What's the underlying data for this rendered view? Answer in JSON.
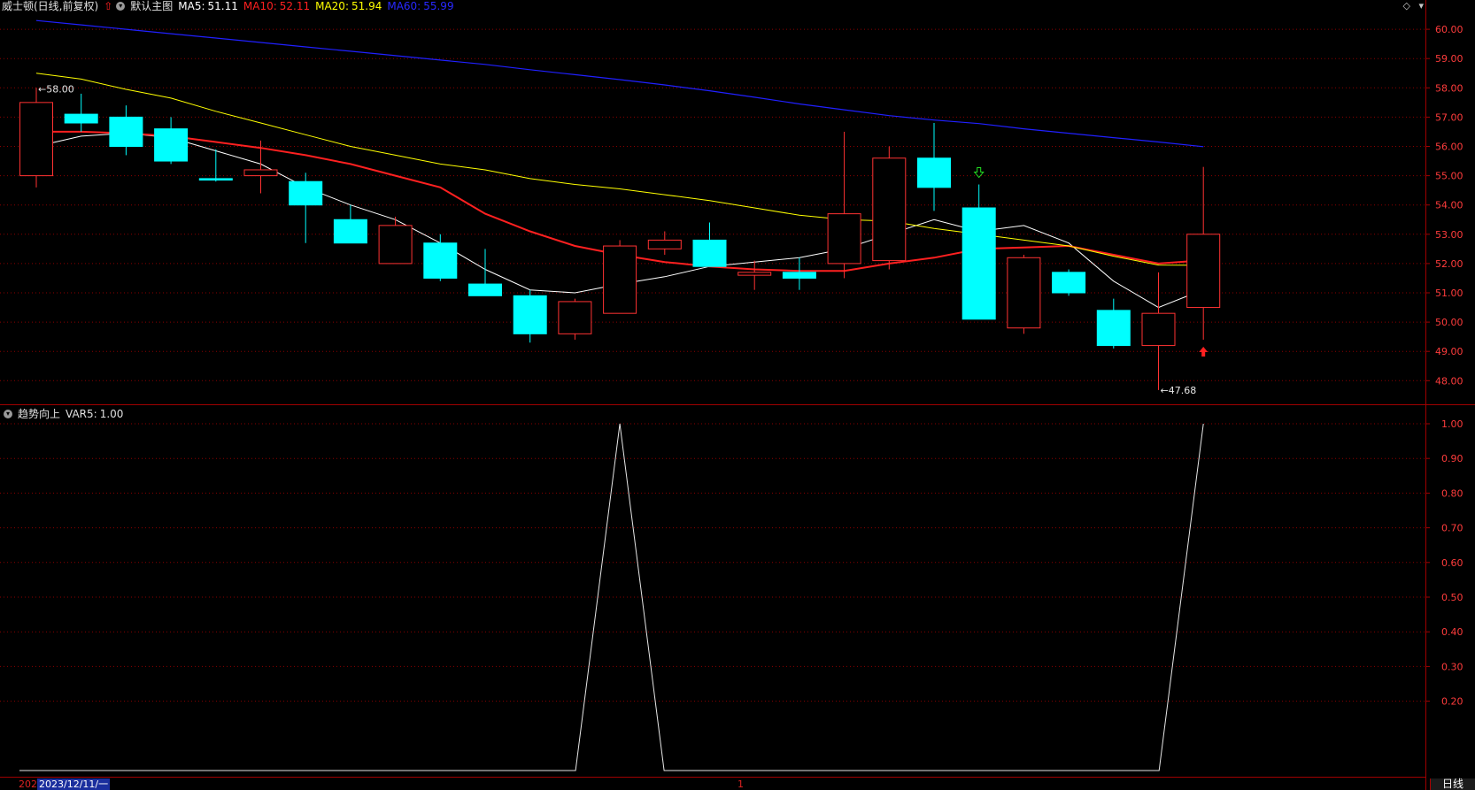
{
  "header": {
    "stock_title": "威士顿(日线,前复权)",
    "main_chart_name": "默认主图",
    "ma5": {
      "label": "MA5:",
      "value": "51.11",
      "color": "#ffffff"
    },
    "ma10": {
      "label": "MA10:",
      "value": "52.11",
      "color": "#ff2020"
    },
    "ma20": {
      "label": "MA20:",
      "value": "51.94",
      "color": "#ffff00"
    },
    "ma60": {
      "label": "MA60:",
      "value": "55.99",
      "color": "#2020ff"
    }
  },
  "indicator": {
    "name": "趋势向上",
    "var_label": "VAR5:",
    "var_value": "1.00"
  },
  "footer": {
    "date_year": "202",
    "selected_date": "2023/12/11/一",
    "marker": "1",
    "period": "日线"
  },
  "colors": {
    "up": "#ff3232",
    "down": "#00ffff",
    "grid": "#8b0000",
    "background": "#000000"
  },
  "chart_data": [
    {
      "type": "candlestick",
      "y_axis": [
        "60.00",
        "59.00",
        "58.00",
        "57.00",
        "56.00",
        "55.00",
        "54.00",
        "53.00",
        "52.00",
        "51.00",
        "50.00",
        "49.00",
        "48.00"
      ],
      "ylim": [
        47.68,
        60.0
      ],
      "annotations": {
        "high_label": "58.00",
        "low_label": "47.68"
      },
      "candles": [
        {
          "o": 55.0,
          "h": 58.0,
          "l": 54.6,
          "c": 57.5
        },
        {
          "o": 57.1,
          "h": 57.8,
          "l": 56.5,
          "c": 56.8
        },
        {
          "o": 57.0,
          "h": 57.4,
          "l": 55.7,
          "c": 56.0
        },
        {
          "o": 56.6,
          "h": 57.0,
          "l": 55.4,
          "c": 55.5
        },
        {
          "o": 54.9,
          "h": 55.9,
          "l": 54.8,
          "c": 54.85
        },
        {
          "o": 55.0,
          "h": 56.2,
          "l": 54.4,
          "c": 55.2
        },
        {
          "o": 54.8,
          "h": 55.1,
          "l": 52.7,
          "c": 54.0
        },
        {
          "o": 53.5,
          "h": 54.0,
          "l": 52.7,
          "c": 52.7
        },
        {
          "o": 52.0,
          "h": 53.6,
          "l": 52.0,
          "c": 53.3
        },
        {
          "o": 52.7,
          "h": 53.0,
          "l": 51.4,
          "c": 51.5
        },
        {
          "o": 51.3,
          "h": 52.5,
          "l": 50.9,
          "c": 50.9
        },
        {
          "o": 50.9,
          "h": 51.1,
          "l": 49.3,
          "c": 49.6
        },
        {
          "o": 49.6,
          "h": 50.8,
          "l": 49.4,
          "c": 50.7
        },
        {
          "o": 50.3,
          "h": 52.8,
          "l": 50.3,
          "c": 52.6
        },
        {
          "o": 52.5,
          "h": 53.1,
          "l": 52.3,
          "c": 52.8
        },
        {
          "o": 52.8,
          "h": 53.4,
          "l": 51.9,
          "c": 51.9
        },
        {
          "o": 51.6,
          "h": 52.1,
          "l": 51.1,
          "c": 51.7
        },
        {
          "o": 51.7,
          "h": 52.2,
          "l": 51.1,
          "c": 51.5
        },
        {
          "o": 52.0,
          "h": 56.5,
          "l": 51.5,
          "c": 53.7
        },
        {
          "o": 52.1,
          "h": 56.0,
          "l": 51.8,
          "c": 55.6
        },
        {
          "o": 55.6,
          "h": 56.8,
          "l": 53.8,
          "c": 54.6
        },
        {
          "o": 53.9,
          "h": 54.7,
          "l": 50.1,
          "c": 50.1
        },
        {
          "o": 49.8,
          "h": 52.3,
          "l": 49.6,
          "c": 52.2
        },
        {
          "o": 51.7,
          "h": 51.8,
          "l": 50.9,
          "c": 51.0
        },
        {
          "o": 50.4,
          "h": 50.8,
          "l": 49.1,
          "c": 49.2
        },
        {
          "o": 49.2,
          "h": 51.7,
          "l": 47.68,
          "c": 50.3
        },
        {
          "o": 50.5,
          "h": 55.3,
          "l": 49.4,
          "c": 53.0
        }
      ],
      "series": [
        {
          "name": "MA5",
          "values": [
            56.0,
            56.35,
            56.45,
            56.3,
            55.85,
            55.4,
            54.6,
            54.0,
            53.5,
            52.7,
            51.8,
            51.1,
            51.0,
            51.3,
            51.55,
            51.9,
            52.05,
            52.2,
            52.5,
            53.0,
            53.5,
            53.1,
            53.3,
            52.7,
            51.4,
            50.5,
            51.11
          ]
        },
        {
          "name": "MA10",
          "values": [
            56.5,
            56.5,
            56.45,
            56.35,
            56.15,
            55.95,
            55.7,
            55.4,
            55.0,
            54.6,
            53.7,
            53.1,
            52.6,
            52.3,
            52.05,
            51.9,
            51.8,
            51.75,
            51.75,
            52.0,
            52.2,
            52.5,
            52.55,
            52.6,
            52.3,
            52.0,
            52.11
          ]
        },
        {
          "name": "MA20",
          "values": [
            58.5,
            58.3,
            57.95,
            57.65,
            57.2,
            56.8,
            56.4,
            56.0,
            55.7,
            55.4,
            55.2,
            54.9,
            54.7,
            54.55,
            54.35,
            54.15,
            53.9,
            53.65,
            53.5,
            53.45,
            53.2,
            53.0,
            52.8,
            52.6,
            52.25,
            51.95,
            51.94
          ]
        },
        {
          "name": "MA60",
          "values": [
            60.3,
            60.15,
            60.0,
            59.85,
            59.7,
            59.55,
            59.4,
            59.25,
            59.1,
            58.95,
            58.8,
            58.62,
            58.45,
            58.28,
            58.1,
            57.9,
            57.68,
            57.45,
            57.25,
            57.05,
            56.9,
            56.78,
            56.6,
            56.45,
            56.3,
            56.15,
            55.99
          ]
        }
      ],
      "signals": {
        "up_arrow_index": 26,
        "down_arrow_index": 21
      }
    },
    {
      "type": "line",
      "name": "VAR5",
      "y_axis": [
        "1.00",
        "0.90",
        "0.80",
        "0.70",
        "0.60",
        "0.50",
        "0.40",
        "0.30",
        "0.20"
      ],
      "ylim": [
        0,
        1.0
      ],
      "values": [
        0,
        0,
        0,
        0,
        0,
        0,
        0,
        0,
        0,
        0,
        0,
        0,
        0,
        1,
        0,
        0,
        0,
        0,
        0,
        0,
        0,
        0,
        0,
        0,
        0,
        0,
        1
      ]
    }
  ]
}
